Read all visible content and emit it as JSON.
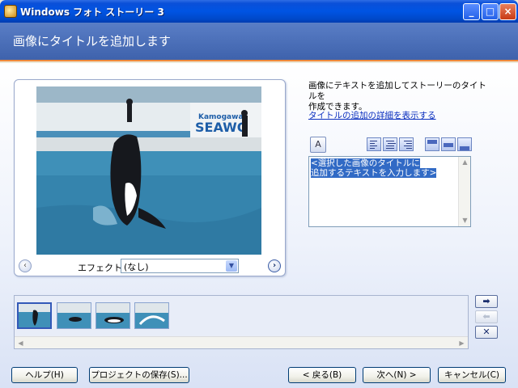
{
  "window": {
    "title": "Windows フォト ストーリー 3",
    "minimize": "_",
    "maximize": "□",
    "close": "×"
  },
  "header": {
    "title": "画像にタイトルを追加します"
  },
  "preview": {
    "effect_label": "エフェクト(E):",
    "effect_value": "(なし)",
    "prev": "‹",
    "next": "›",
    "dropdown": "▼"
  },
  "right": {
    "description_line1": "画像にテキストを追加してストーリーのタイトルを",
    "description_line2": "作成できます。",
    "details_link": "タイトルの追加の詳細を表示する",
    "font_button": "A",
    "text_line1": "<選択した画像のタイトルに",
    "text_line2": "追加するテキストを入力します>",
    "scroll_up": "▲",
    "scroll_down": "▼"
  },
  "filmstrip": {
    "thumbnails": 4,
    "selected_index": 0,
    "scroll_left": "◀",
    "scroll_right": "▶",
    "move_right": "➡",
    "move_left": "⬅",
    "delete": "✕"
  },
  "buttons": {
    "help": "ヘルプ(H)",
    "save_project": "プロジェクトの保存(S)...",
    "back": "< 戻る(B)",
    "next": "次へ(N) >",
    "cancel": "キャンセル(C)"
  },
  "colors": {
    "title_bar": "#0054e3",
    "header_band": "#4a6fb8",
    "header_accent": "#f08a3c",
    "selection": "#316ac5",
    "link": "#0a2fbf"
  }
}
